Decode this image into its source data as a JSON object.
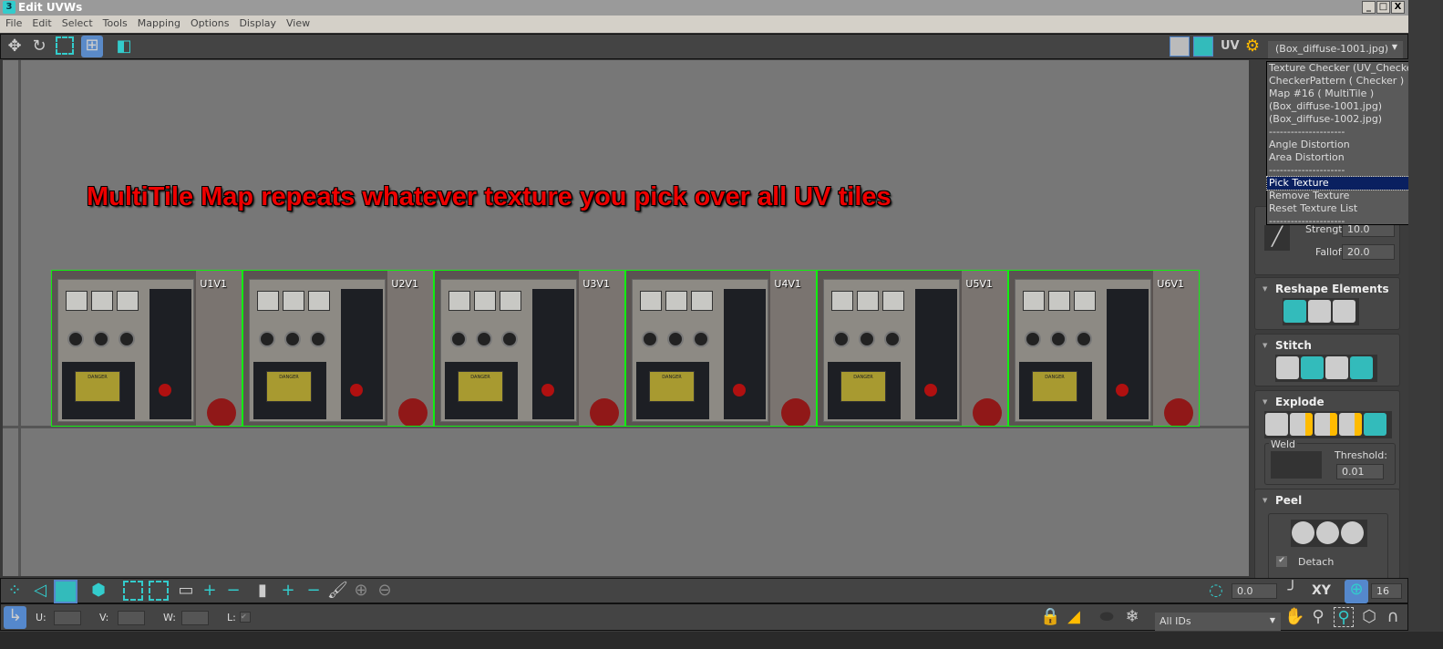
{
  "window": {
    "title": "Edit UVWs",
    "logo": "3",
    "controls": [
      "_",
      "□",
      "X"
    ]
  },
  "menu": [
    "File",
    "Edit",
    "Select",
    "Tools",
    "Mapping",
    "Options",
    "Display",
    "View"
  ],
  "toolbar": {
    "icons": [
      "move-icon",
      "rotate-icon",
      "scale-icon",
      "freeform-icon",
      "mirror-icon"
    ],
    "uv_label": "UV",
    "texture_select": "(Box_diffuse-1001.jpg)"
  },
  "dropdown": {
    "items": [
      "Texture Checker (UV_Checker.png)",
      "CheckerPattern  ( Checker )",
      "Map #16  ( MultiTile )",
      " (Box_diffuse-1001.jpg)",
      " (Box_diffuse-1002.jpg)",
      "---------------------",
      "Angle Distortion",
      "Area Distortion",
      "---------------------",
      "Pick Texture",
      "Remove Texture",
      "Reset Texture List",
      "---------------------"
    ],
    "selected": "Pick Texture"
  },
  "annotation": "MultiTile Map repeats whatever texture you pick over all UV tiles",
  "tiles": [
    "U1V1",
    "U2V1",
    "U3V1",
    "U4V1",
    "U5V1",
    "U6V1"
  ],
  "tile_sign": "DANGER",
  "right_panel": {
    "strength_label": "Strength:",
    "strength_value": "10.0",
    "falloff_label": "Falloff:",
    "falloff_value": "20.0",
    "reshape": "Reshape Elements",
    "stitch": "Stitch",
    "explode": "Explode",
    "weld": "Weld",
    "threshold_label": "Threshold:",
    "threshold_value": "0.01",
    "peel": "Peel",
    "detach": "Detach"
  },
  "bottom": {
    "angle_value": "0.0",
    "xy_label": "XY",
    "grid_value": "16",
    "u_label": "U:",
    "v_label": "V:",
    "w_label": "W:",
    "l_label": "L:",
    "ids_select": "All IDs"
  },
  "colors": {
    "accent": "#33cccc",
    "tile_border": "#22ee22",
    "annotation": "#ee0000",
    "selected": "#0a2060"
  }
}
